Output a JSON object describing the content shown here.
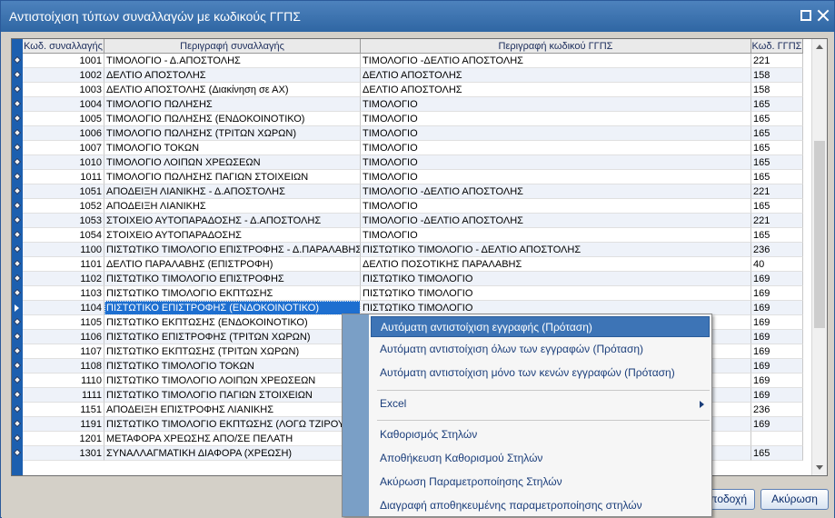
{
  "window": {
    "title": "Αντιστοίχιση τύπων συναλλαγών με κωδικούς ΓΓΠΣ"
  },
  "grid": {
    "columns": [
      "Κωδ. συναλλαγής",
      "Περιγραφή συναλλαγής",
      "Περιγραφή κωδικού ΓΓΠΣ",
      "Κωδ. ΓΓΠΣ"
    ],
    "rows": [
      {
        "code": "1001",
        "desc": "ΤΙΜΟΛΟΓΙΟ - Δ.ΑΠΟΣΤΟΛΗΣ",
        "gdesc": "ΤΙΜΟΛΟΓΙΟ -ΔΕΛΤΙΟ ΑΠΟΣΤΟΛΗΣ",
        "ggps": "221"
      },
      {
        "code": "1002",
        "desc": "ΔΕΛΤΙΟ ΑΠΟΣΤΟΛΗΣ",
        "gdesc": "ΔΕΛΤΙΟ ΑΠΟΣΤΟΛΗΣ",
        "ggps": "158"
      },
      {
        "code": "1003",
        "desc": "ΔΕΛΤΙΟ ΑΠΟΣΤΟΛΗΣ (Διακίνηση σε ΑΧ)",
        "gdesc": "ΔΕΛΤΙΟ ΑΠΟΣΤΟΛΗΣ",
        "ggps": "158"
      },
      {
        "code": "1004",
        "desc": "ΤΙΜΟΛΟΓΙΟ ΠΩΛΗΣΗΣ",
        "gdesc": "ΤΙΜΟΛΟΓΙΟ",
        "ggps": "165"
      },
      {
        "code": "1005",
        "desc": "ΤΙΜΟΛΟΓΙΟ ΠΩΛΗΣΗΣ (ΕΝΔΟΚΟΙΝΟΤΙΚΟ)",
        "gdesc": "ΤΙΜΟΛΟΓΙΟ",
        "ggps": "165"
      },
      {
        "code": "1006",
        "desc": "ΤΙΜΟΛΟΓΙΟ ΠΩΛΗΣΗΣ (ΤΡΙΤΩΝ ΧΩΡΩΝ)",
        "gdesc": "ΤΙΜΟΛΟΓΙΟ",
        "ggps": "165"
      },
      {
        "code": "1007",
        "desc": "ΤΙΜΟΛΟΓΙΟ ΤΟΚΩΝ",
        "gdesc": "ΤΙΜΟΛΟΓΙΟ",
        "ggps": "165"
      },
      {
        "code": "1010",
        "desc": "ΤΙΜΟΛΟΓΙΟ ΛΟΙΠΩΝ ΧΡΕΩΣΕΩΝ",
        "gdesc": "ΤΙΜΟΛΟΓΙΟ",
        "ggps": "165"
      },
      {
        "code": "1011",
        "desc": "ΤΙΜΟΛΟΓΙΟ ΠΩΛΗΣΗΣ ΠΑΓΙΩΝ ΣΤΟΙΧΕΙΩΝ",
        "gdesc": "ΤΙΜΟΛΟΓΙΟ",
        "ggps": "165"
      },
      {
        "code": "1051",
        "desc": "ΑΠΟΔΕΙΞΗ ΛΙΑΝΙΚΗΣ - Δ.ΑΠΟΣΤΟΛΗΣ",
        "gdesc": "ΤΙΜΟΛΟΓΙΟ -ΔΕΛΤΙΟ ΑΠΟΣΤΟΛΗΣ",
        "ggps": "221"
      },
      {
        "code": "1052",
        "desc": "ΑΠΟΔΕΙΞΗ ΛΙΑΝΙΚΗΣ",
        "gdesc": "ΤΙΜΟΛΟΓΙΟ",
        "ggps": "165"
      },
      {
        "code": "1053",
        "desc": "ΣΤΟΙΧΕΙΟ ΑΥΤΟΠΑΡΑΔΟΣΗΣ - Δ.ΑΠΟΣΤΟΛΗΣ",
        "gdesc": "ΤΙΜΟΛΟΓΙΟ -ΔΕΛΤΙΟ ΑΠΟΣΤΟΛΗΣ",
        "ggps": "221"
      },
      {
        "code": "1054",
        "desc": "ΣΤΟΙΧΕΙΟ ΑΥΤΟΠΑΡΑΔΟΣΗΣ",
        "gdesc": "ΤΙΜΟΛΟΓΙΟ",
        "ggps": "165"
      },
      {
        "code": "1100",
        "desc": "ΠΙΣΤΩΤΙΚΟ ΤΙΜΟΛΟΓΙΟ ΕΠΙΣΤΡΟΦΗΣ - Δ.ΠΑΡΑΛΑΒΗΣ",
        "gdesc": "ΠΙΣΤΩΤΙΚΟ ΤΙΜΟΛΟΓΙΟ - ΔΕΛΤΙΟ ΑΠΟΣΤΟΛΗΣ",
        "ggps": "236"
      },
      {
        "code": "1101",
        "desc": "ΔΕΛΤΙΟ ΠΑΡΑΛΑΒΗΣ (ΕΠΙΣΤΡΟΦΗ)",
        "gdesc": "ΔΕΛΤΙΟ ΠΟΣΟΤΙΚΗΣ ΠΑΡΑΛΑΒΗΣ",
        "ggps": "40"
      },
      {
        "code": "1102",
        "desc": "ΠΙΣΤΩΤΙΚΟ ΤΙΜΟΛΟΓΙΟ ΕΠΙΣΤΡΟΦΗΣ",
        "gdesc": "ΠΙΣΤΩΤΙΚΟ ΤΙΜΟΛΟΓΙΟ",
        "ggps": "169"
      },
      {
        "code": "1103",
        "desc": "ΠΙΣΤΩΤΙΚΟ ΤΙΜΟΛΟΓΙΟ ΕΚΠΤΩΣΗΣ",
        "gdesc": "ΠΙΣΤΩΤΙΚΟ ΤΙΜΟΛΟΓΙΟ",
        "ggps": "169"
      },
      {
        "code": "1104",
        "desc": "ΠΙΣΤΩΤΙΚΟ ΕΠΙΣΤΡΟΦΗΣ (ΕΝΔΟΚΟΙΝΟΤΙΚΟ)",
        "gdesc": "ΠΙΣΤΩΤΙΚΟ ΤΙΜΟΛΟΓΙΟ",
        "ggps": "169"
      },
      {
        "code": "1105",
        "desc": "ΠΙΣΤΩΤΙΚΟ ΕΚΠΤΩΣΗΣ (ΕΝΔΟΚΟΙΝΟΤΙΚΟ)",
        "gdesc": "",
        "ggps": "169"
      },
      {
        "code": "1106",
        "desc": "ΠΙΣΤΩΤΙΚΟ ΕΠΙΣΤΡΟΦΗΣ (ΤΡΙΤΩΝ ΧΩΡΩΝ)",
        "gdesc": "",
        "ggps": "169"
      },
      {
        "code": "1107",
        "desc": "ΠΙΣΤΩΤΙΚΟ ΕΚΠΤΩΣΗΣ (ΤΡΙΤΩΝ ΧΩΡΩΝ)",
        "gdesc": "",
        "ggps": "169"
      },
      {
        "code": "1108",
        "desc": "ΠΙΣΤΩΤΙΚΟ ΤΙΜΟΛΟΓΙΟ ΤΟΚΩΝ",
        "gdesc": "",
        "ggps": "169"
      },
      {
        "code": "1110",
        "desc": "ΠΙΣΤΩΤΙΚΟ ΤΙΜΟΛΟΓΙΟ ΛΟΙΠΩΝ ΧΡΕΩΣΕΩΝ",
        "gdesc": "",
        "ggps": "169"
      },
      {
        "code": "1111",
        "desc": "ΠΙΣΤΩΤΙΚΟ ΤΙΜΟΛΟΓΙΟ ΠΑΓΙΩΝ ΣΤΟΙΧΕΙΩΝ",
        "gdesc": "",
        "ggps": "169"
      },
      {
        "code": "1151",
        "desc": "ΑΠΟΔΕΙΞΗ ΕΠΙΣΤΡΟΦΗΣ ΛΙΑΝΙΚΗΣ",
        "gdesc": "",
        "ggps": "236"
      },
      {
        "code": "1191",
        "desc": "ΠΙΣΤΩΤΙΚΟ ΤΙΜΟΛΟΓΙΟ ΕΚΠΤΩΣΗΣ (ΛΟΓΩ ΤΖΙΡΟΥ)",
        "gdesc": "",
        "ggps": "169"
      },
      {
        "code": "1201",
        "desc": "ΜΕΤΑΦΟΡΑ ΧΡΕΩΣΗΣ ΑΠΟ/ΣΕ ΠΕΛΑΤΗ",
        "gdesc": "",
        "ggps": ""
      },
      {
        "code": "1301",
        "desc": "ΣΥΝΑΛΛΑΓΜΑΤΙΚΗ ΔΙΑΦΟΡΑ (ΧΡΕΩΣΗ)",
        "gdesc": "",
        "ggps": "165"
      }
    ]
  },
  "context_menu": {
    "items": [
      "Αυτόματη αντιστοίχιση εγγραφής (Πρόταση)",
      "Αυτόματη αντιστοίχιση όλων των εγγραφών (Πρόταση)",
      "Αυτόματη αντιστοίχιση μόνο των κενών εγγραφών (Πρόταση)",
      "Excel",
      "Καθορισμός Στηλών",
      "Αποθήκευση Καθορισμού Στηλών",
      "Ακύρωση Παραμετροποίησης Στηλών",
      "Διαγραφή αποθηκευμένης παραμετροποίησης στηλών"
    ]
  },
  "buttons": {
    "ok": "ποδοχή",
    "cancel": "Ακύρωση"
  }
}
